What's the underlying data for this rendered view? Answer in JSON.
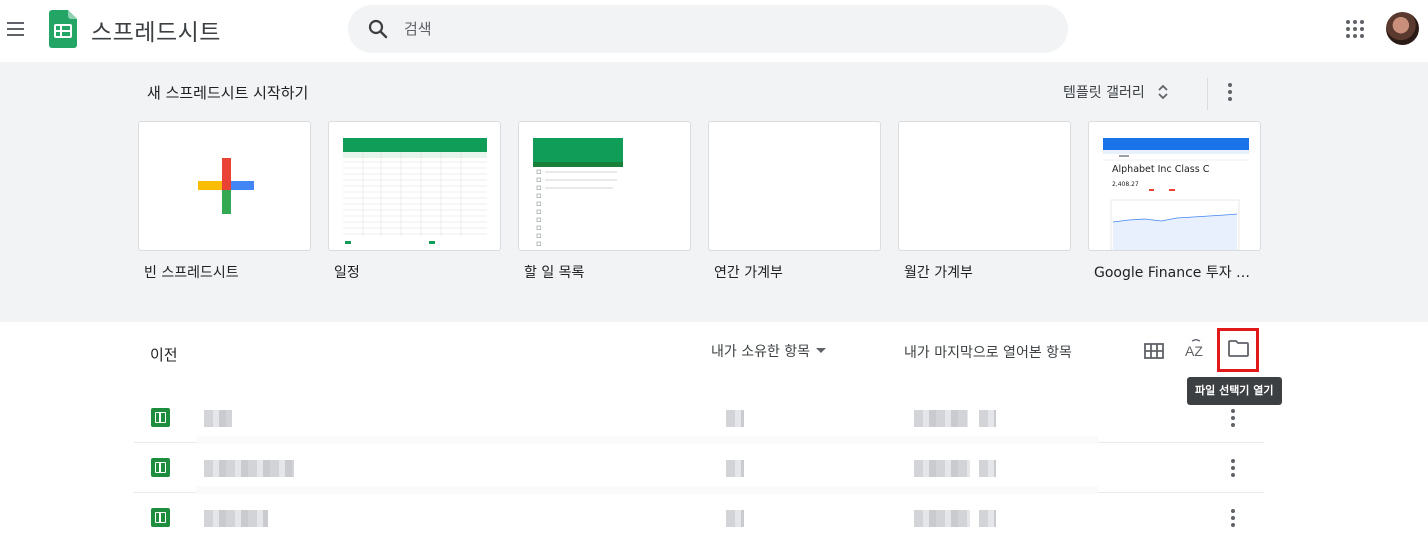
{
  "app": {
    "title": "스프레드시트"
  },
  "search": {
    "placeholder": "검색"
  },
  "gallery": {
    "heading": "새 스프레드시트 시작하기",
    "template_gallery_label": "템플릿 갤러리",
    "templates": [
      {
        "label": "빈 스프레드시트"
      },
      {
        "label": "일정"
      },
      {
        "label": "할 일 목록"
      },
      {
        "label": "연간 가계부"
      },
      {
        "label": "월간 가계부"
      },
      {
        "label": "Google Finance 투자 추..."
      }
    ],
    "finance_preview": {
      "title": "Alphabet Inc Class C",
      "price": "2,408.27"
    }
  },
  "recent": {
    "heading": "이전",
    "owner_filter": "내가 소유한 항목",
    "sort_label": "내가 마지막으로 열어본 항목",
    "picker_tooltip": "파일 선택기 열기",
    "sort_icon_text": "AZ"
  },
  "colors": {
    "sheets_green": "#1e8e3e",
    "gallery_bg": "#f1f3f4",
    "highlight_red": "#e0191a",
    "tooltip_bg": "#3c4043"
  },
  "icons": [
    "menu-icon",
    "sheets-logo-icon",
    "search-icon",
    "apps-grid-icon",
    "more-vert-icon",
    "unfold-icon",
    "grid-view-icon",
    "sort-az-icon",
    "folder-icon",
    "sheets-file-icon"
  ]
}
